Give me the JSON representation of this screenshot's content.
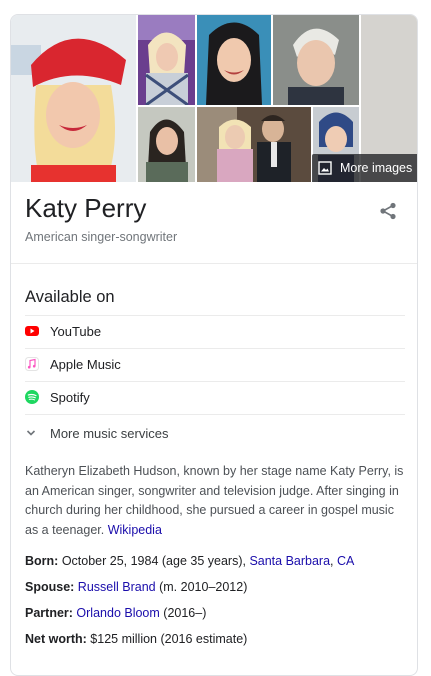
{
  "knowledge_panel": {
    "more_images_label": "More images",
    "title": "Katy Perry",
    "subtitle": "American singer-songwriter",
    "available_on": {
      "heading": "Available on",
      "services": [
        {
          "name": "YouTube",
          "icon": "youtube-icon",
          "color": "#ff0000"
        },
        {
          "name": "Apple Music",
          "icon": "apple-music-icon",
          "color": "#fa57c1"
        },
        {
          "name": "Spotify",
          "icon": "spotify-icon",
          "color": "#1ed760"
        }
      ],
      "more_label": "More music services"
    },
    "description": "Katheryn Elizabeth Hudson, known by her stage name Katy Perry, is an American singer, songwriter and television judge. After singing in church during her childhood, she pursued a career in gospel music as a teenager.",
    "description_source": "Wikipedia",
    "facts": {
      "born": {
        "label": "Born:",
        "text": "October 25, 1984 (age 35 years),",
        "link1": "Santa Barbara",
        "sep": ",",
        "link2": "CA"
      },
      "spouse": {
        "label": "Spouse:",
        "link": "Russell Brand",
        "text": "(m. 2010–2012)"
      },
      "partner": {
        "label": "Partner:",
        "link": "Orlando Bloom",
        "text": "(2016–)"
      },
      "net_worth": {
        "label": "Net worth:",
        "text": "$125 million (2016 estimate)"
      }
    },
    "colors": {
      "link": "#1a0dab",
      "text": "#202124",
      "muted": "#70757a"
    }
  }
}
